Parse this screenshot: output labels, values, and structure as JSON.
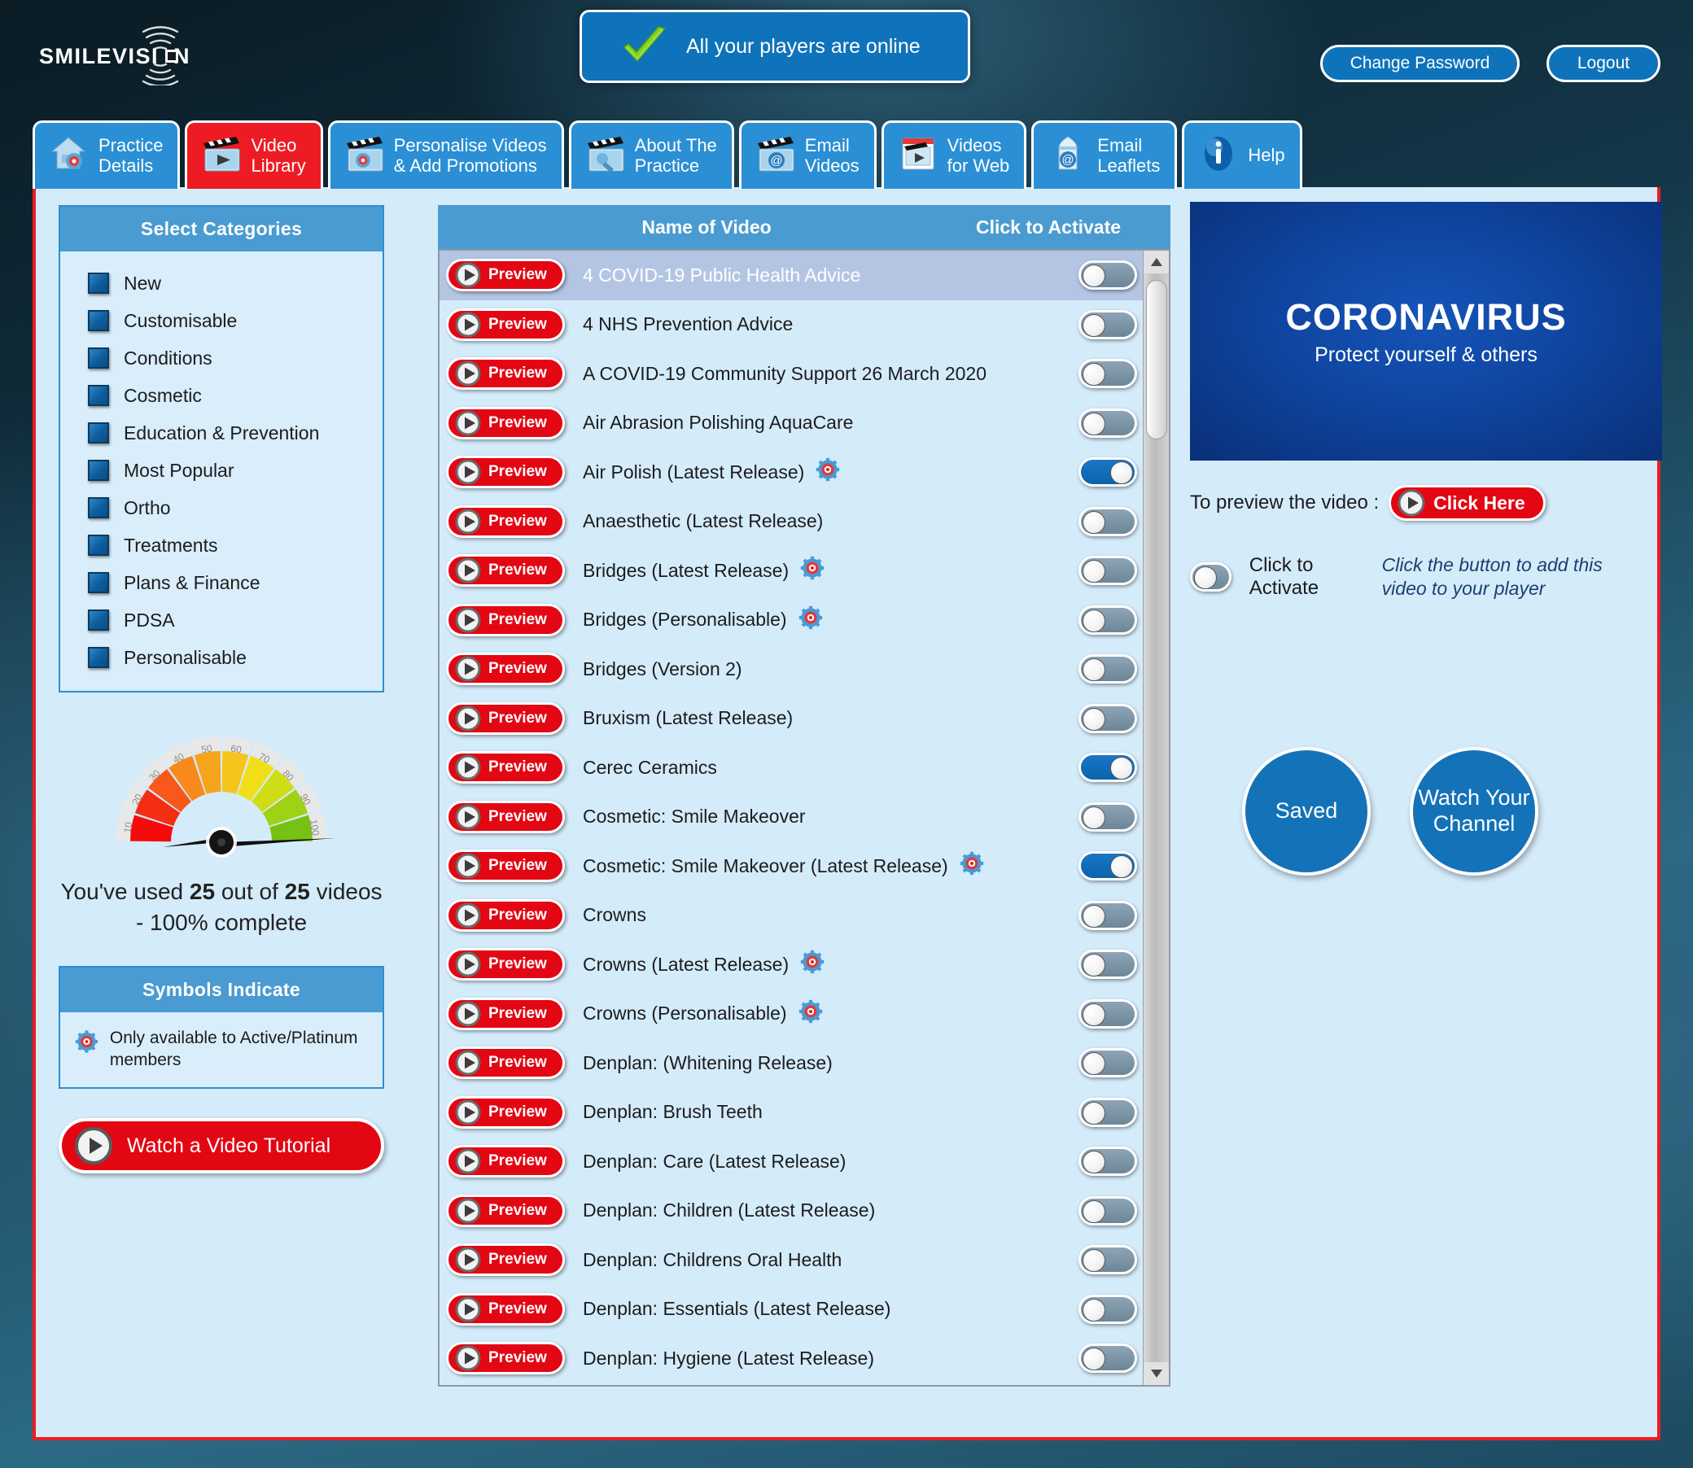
{
  "brand": {
    "name": "SMILEVISI",
    "name_suffix": "N"
  },
  "header": {
    "status_text": "All your players are online",
    "status_icon": "green-tick-icon",
    "change_password": "Change Password",
    "logout": "Logout",
    "accent_blue": "#0e73ba",
    "accent_red": "#ed1c24"
  },
  "tabs": [
    {
      "label": "Practice\nDetails",
      "icon": "house-gear-icon",
      "active": false
    },
    {
      "label": "Video\nLibrary",
      "icon": "clapperboard-play-icon",
      "active": true
    },
    {
      "label": "Personalise Videos\n& Add Promotions",
      "icon": "clapperboard-gear-icon",
      "active": false
    },
    {
      "label": "About The\nPractice",
      "icon": "clapperboard-tool-icon",
      "active": false
    },
    {
      "label": "Email\nVideos",
      "icon": "clapperboard-at-icon",
      "active": false
    },
    {
      "label": "Videos\nfor Web",
      "icon": "browser-video-icon",
      "active": false
    },
    {
      "label": "Email\nLeaflets",
      "icon": "leaflet-at-icon",
      "active": false
    },
    {
      "label": "Help",
      "icon": "info-icon",
      "active": false
    }
  ],
  "sidebar": {
    "categories_title": "Select Categories",
    "categories": [
      "New",
      "Customisable",
      "Conditions",
      "Cosmetic",
      "Education & Prevention",
      "Most Popular",
      "Ortho",
      "Treatments",
      "Plans & Finance",
      "PDSA",
      "Personalisable"
    ],
    "gauge": {
      "ticks": [
        "10",
        "20",
        "30",
        "40",
        "50",
        "60",
        "70",
        "80",
        "90",
        "100"
      ],
      "value": 100,
      "min": 0,
      "max": 100
    },
    "usage_prefix": "You've used ",
    "usage_used": "25",
    "usage_middle": " out of ",
    "usage_total": "25",
    "usage_suffix": " videos - 100% complete",
    "symbols_title": "Symbols Indicate",
    "symbols_icon": "gear-target-icon",
    "symbols_text": "Only available to Active/Platinum members",
    "tutorial_label": "Watch a Video Tutorial",
    "tutorial_icon": "play-circle-icon"
  },
  "video_list": {
    "col_name": "Name of Video",
    "col_activate": "Click to Activate",
    "preview_label": "Preview",
    "preview_icon": "play-circle-icon",
    "gear_icon": "gear-target-icon",
    "rows": [
      {
        "name": "4 COVID-19 Public Health Advice",
        "gear": false,
        "on": false,
        "selected": true
      },
      {
        "name": "4 NHS Prevention Advice",
        "gear": false,
        "on": false,
        "selected": false
      },
      {
        "name": "A COVID-19 Community Support 26 March 2020",
        "gear": false,
        "on": false,
        "selected": false
      },
      {
        "name": "Air Abrasion Polishing AquaCare",
        "gear": false,
        "on": false,
        "selected": false
      },
      {
        "name": "Air Polish (Latest Release)",
        "gear": true,
        "on": true,
        "selected": false
      },
      {
        "name": "Anaesthetic (Latest Release)",
        "gear": false,
        "on": false,
        "selected": false
      },
      {
        "name": "Bridges (Latest Release)",
        "gear": true,
        "on": false,
        "selected": false
      },
      {
        "name": "Bridges (Personalisable)",
        "gear": true,
        "on": false,
        "selected": false
      },
      {
        "name": "Bridges (Version 2)",
        "gear": false,
        "on": false,
        "selected": false
      },
      {
        "name": "Bruxism (Latest Release)",
        "gear": false,
        "on": false,
        "selected": false
      },
      {
        "name": "Cerec Ceramics",
        "gear": false,
        "on": true,
        "selected": false
      },
      {
        "name": "Cosmetic: Smile Makeover",
        "gear": false,
        "on": false,
        "selected": false
      },
      {
        "name": "Cosmetic: Smile Makeover (Latest Release)",
        "gear": true,
        "on": true,
        "selected": false
      },
      {
        "name": "Crowns",
        "gear": false,
        "on": false,
        "selected": false
      },
      {
        "name": "Crowns (Latest Release)",
        "gear": true,
        "on": false,
        "selected": false
      },
      {
        "name": "Crowns (Personalisable)",
        "gear": true,
        "on": false,
        "selected": false
      },
      {
        "name": "Denplan: (Whitening Release)",
        "gear": false,
        "on": false,
        "selected": false
      },
      {
        "name": "Denplan: Brush Teeth",
        "gear": false,
        "on": false,
        "selected": false
      },
      {
        "name": "Denplan: Care (Latest Release)",
        "gear": false,
        "on": false,
        "selected": false
      },
      {
        "name": "Denplan: Children (Latest Release)",
        "gear": false,
        "on": false,
        "selected": false
      },
      {
        "name": "Denplan: Childrens Oral Health",
        "gear": false,
        "on": false,
        "selected": false
      },
      {
        "name": "Denplan: Essentials (Latest Release)",
        "gear": false,
        "on": false,
        "selected": false
      },
      {
        "name": "Denplan: Hygiene (Latest Release)",
        "gear": false,
        "on": false,
        "selected": false
      }
    ]
  },
  "right": {
    "preview_title": "CORONAVIRUS",
    "preview_subtitle": "Protect yourself & others",
    "preview_prompt": "To preview the video :",
    "click_here": "Click Here",
    "activate_label": "Click to Activate",
    "activate_on": false,
    "hint": "Click the button to add this video to your player",
    "saved_label": "Saved",
    "channel_label": "Watch Your Channel"
  }
}
